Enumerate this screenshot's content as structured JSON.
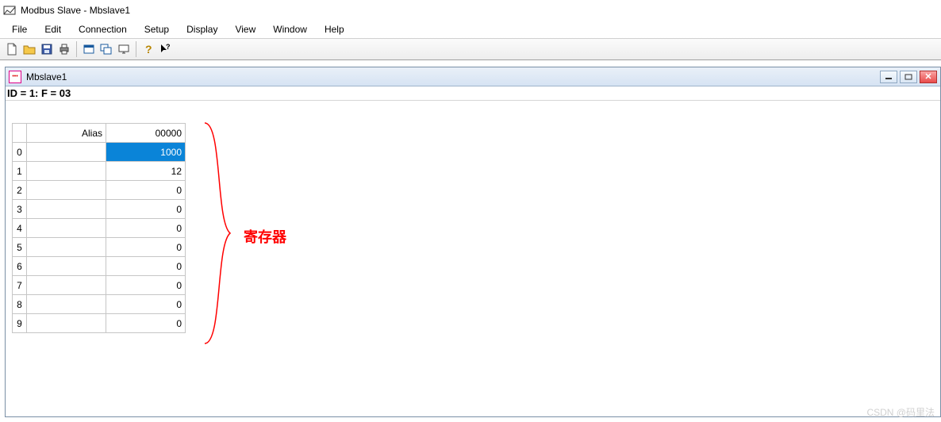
{
  "app": {
    "title": "Modbus Slave - Mbslave1"
  },
  "menu": {
    "items": [
      "File",
      "Edit",
      "Connection",
      "Setup",
      "Display",
      "View",
      "Window",
      "Help"
    ]
  },
  "child": {
    "title": "Mbslave1",
    "status": "ID = 1: F = 03"
  },
  "grid": {
    "header_corner": "",
    "header_alias": "Alias",
    "header_value": "00000",
    "rows": [
      {
        "idx": "0",
        "alias": "",
        "value": "1000",
        "selected": true
      },
      {
        "idx": "1",
        "alias": "",
        "value": "12"
      },
      {
        "idx": "2",
        "alias": "",
        "value": "0"
      },
      {
        "idx": "3",
        "alias": "",
        "value": "0"
      },
      {
        "idx": "4",
        "alias": "",
        "value": "0"
      },
      {
        "idx": "5",
        "alias": "",
        "value": "0"
      },
      {
        "idx": "6",
        "alias": "",
        "value": "0"
      },
      {
        "idx": "7",
        "alias": "",
        "value": "0"
      },
      {
        "idx": "8",
        "alias": "",
        "value": "0"
      },
      {
        "idx": "9",
        "alias": "",
        "value": "0"
      }
    ]
  },
  "annotation": {
    "label": "寄存器"
  },
  "watermark": "CSDN @码里法"
}
